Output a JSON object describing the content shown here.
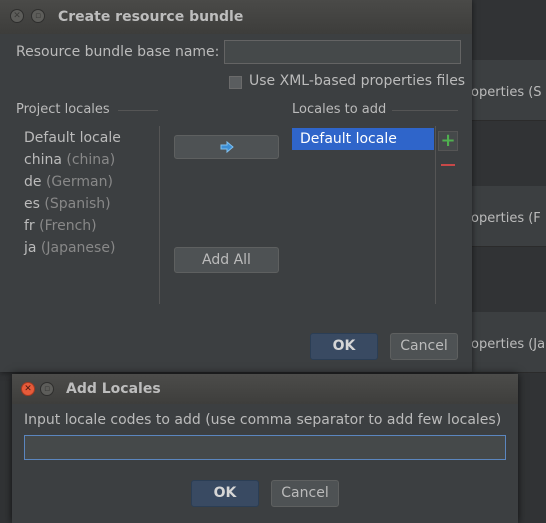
{
  "background": {
    "items": [
      "roperties (S",
      "roperties (F",
      "roperties (Ja"
    ]
  },
  "create_dialog": {
    "title": "Create resource bundle",
    "base_name_label": "Resource bundle base name:",
    "base_name_value": "",
    "xml_checkbox_label": "Use XML-based properties files",
    "xml_checked": false,
    "project_locales_label": "Project locales",
    "locales_to_add_label": "Locales to add",
    "project_locales": [
      {
        "code": "Default locale",
        "name": ""
      },
      {
        "code": "china",
        "name": "(china)"
      },
      {
        "code": "de",
        "name": "(German)"
      },
      {
        "code": "es",
        "name": "(Spanish)"
      },
      {
        "code": "fr",
        "name": "(French)"
      },
      {
        "code": "ja",
        "name": "(Japanese)"
      }
    ],
    "locales_to_add": [
      "Default locale"
    ],
    "move_icon": "arrow-right-icon",
    "add_all_label": "Add All",
    "ok_label": "OK",
    "cancel_label": "Cancel",
    "plus_icon": "plus-icon",
    "minus_icon": "minus-icon"
  },
  "add_locales_dialog": {
    "title": "Add Locales",
    "prompt": "Input locale codes to add (use comma separator to add few locales)",
    "input_value": "",
    "ok_label": "OK",
    "cancel_label": "Cancel"
  },
  "colors": {
    "selection": "#2f65ca",
    "accent_ok": "#394a62",
    "add_green": "#4fb04f",
    "remove_red": "#c74848"
  }
}
